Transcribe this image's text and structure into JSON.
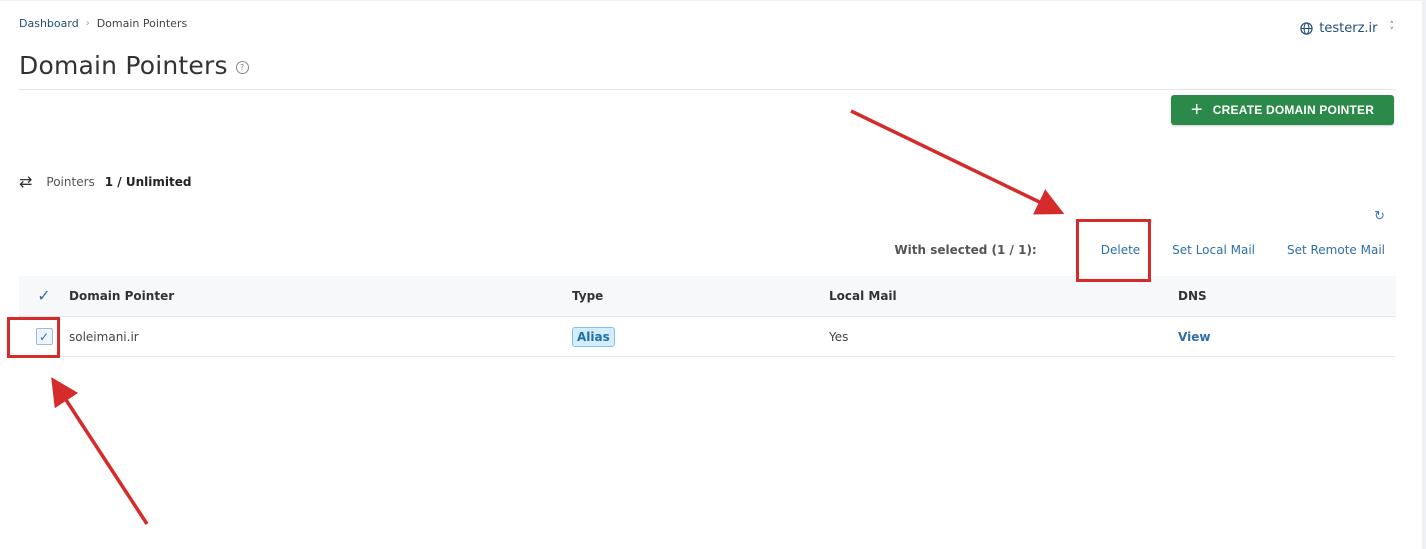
{
  "breadcrumb": {
    "home": "Dashboard",
    "separator": "›",
    "current": "Domain Pointers"
  },
  "domain_selector": {
    "value": "testerz.ir",
    "icon": "globe-icon"
  },
  "page": {
    "title": "Domain Pointers",
    "help_icon": "?"
  },
  "toolbar": {
    "create_label": "CREATE DOMAIN POINTER",
    "create_icon": "+"
  },
  "pointers": {
    "icon": "⇄",
    "label": "Pointers",
    "count": "1 / Unlimited"
  },
  "selection": {
    "label": "With selected (1 / 1):",
    "actions": [
      "Delete",
      "Set Local Mail",
      "Set Remote Mail"
    ]
  },
  "refresh_icon": "↻",
  "table": {
    "headers": [
      "Domain Pointer",
      "Type",
      "Local Mail",
      "DNS"
    ],
    "rows": [
      {
        "domain": "soleimani.ir",
        "type": "Alias",
        "local_mail": "Yes",
        "dns": "View",
        "checked": true
      }
    ]
  },
  "colors": {
    "accent_green": "#2b8a4a",
    "link_blue": "#2e6fa8",
    "annotation_red": "#d62b2b"
  }
}
